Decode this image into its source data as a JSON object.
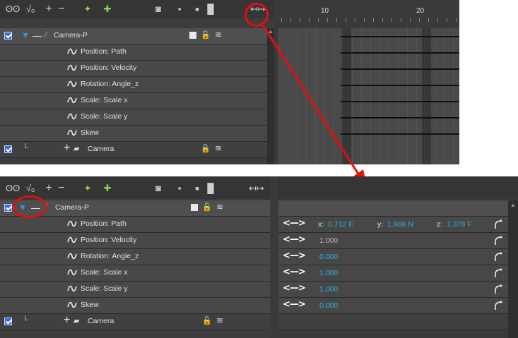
{
  "top_panel": {
    "ruler_labels": [
      "10",
      "20"
    ],
    "layer_label": "Camera-P",
    "rows": [
      "Position: Path",
      "Position: Velocity",
      "Rotation: Angle_z",
      "Scale: Scale x",
      "Scale: Scale y",
      "Skew"
    ],
    "camera_label": "Camera"
  },
  "bottom_panel": {
    "layer_label": "Camera-P",
    "rows": [
      "Position: Path",
      "Position: Velocity",
      "Rotation: Angle_z",
      "Scale: Scale x",
      "Scale: Scale y",
      "Skew"
    ],
    "camera_label": "Camera",
    "path_x_label": "x:",
    "path_x": "0.712 E",
    "path_y_label": "y:",
    "path_y": "1.966 N",
    "path_z_label": "z:",
    "path_z": "1.378 F",
    "values": [
      "1.000",
      "0.000",
      "1.000",
      "1.000",
      "0.000"
    ],
    "arrow_glyph": "<—>"
  },
  "colors": {
    "annotation_red": "#e3100c",
    "value_cyan": "#29b6e8",
    "panel_bg": "#3a3a3a"
  }
}
